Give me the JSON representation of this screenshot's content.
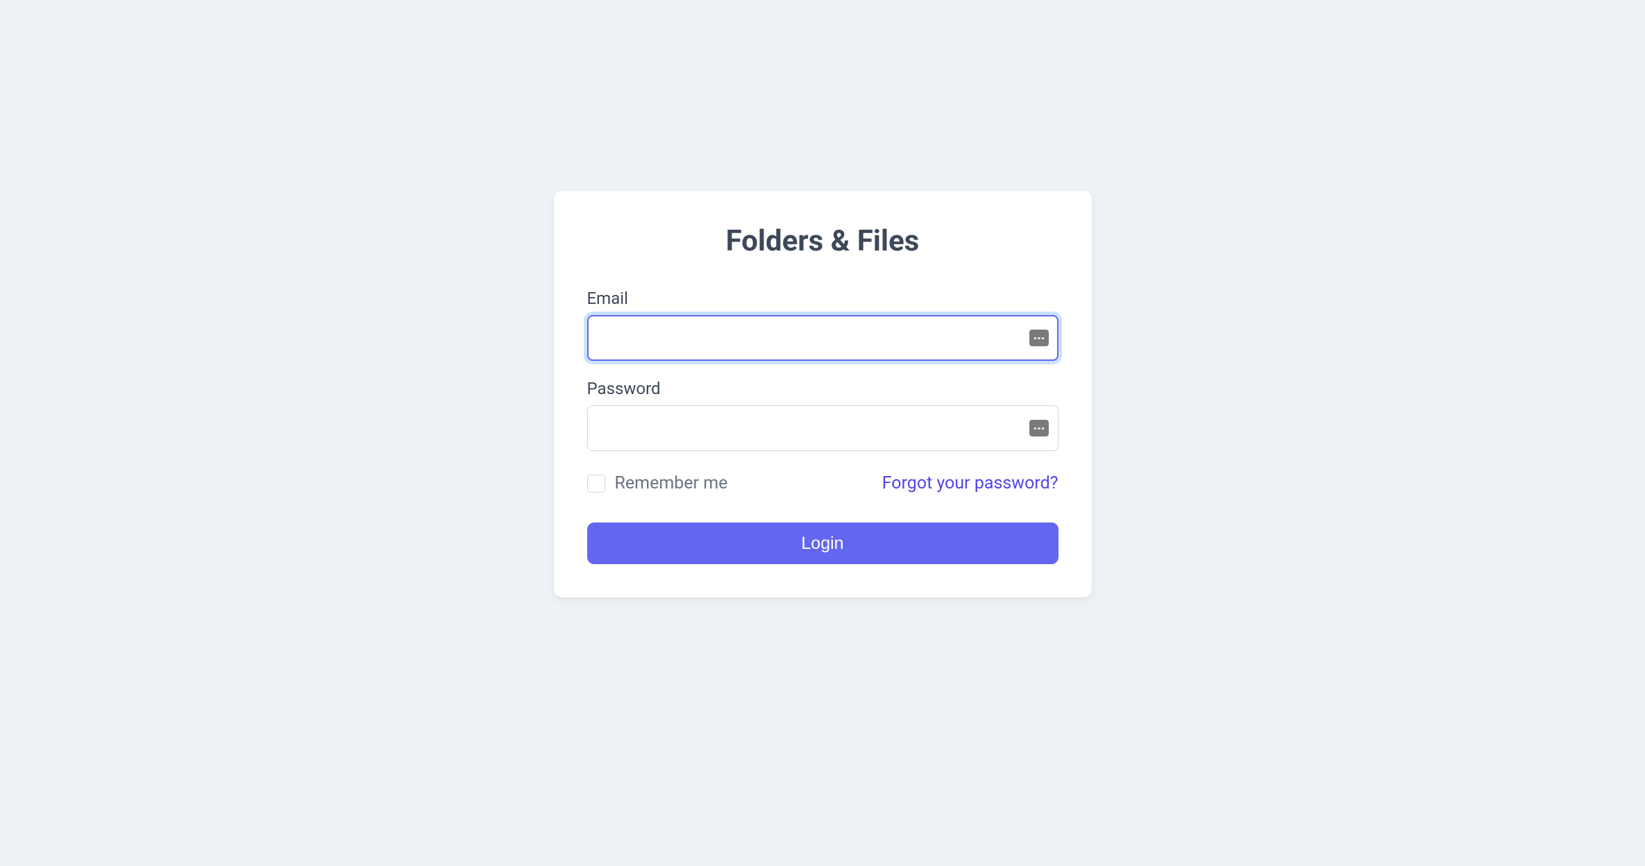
{
  "app": {
    "title": "Folders & Files"
  },
  "form": {
    "email_label": "Email",
    "email_value": "",
    "password_label": "Password",
    "password_value": "",
    "remember_label": "Remember me",
    "forgot_link_text": "Forgot your password?",
    "login_button_label": "Login"
  },
  "colors": {
    "background": "#eef2f6",
    "card_bg": "#ffffff",
    "title_text": "#3d4858",
    "label_text": "#3d4858",
    "input_border": "#d1d5db",
    "focus_border": "#6366f1",
    "focus_ring": "#93c5fd",
    "checkbox_text": "#6b7280",
    "link_text": "#4f46e5",
    "button_bg": "#6366f1",
    "button_text": "#ffffff"
  }
}
